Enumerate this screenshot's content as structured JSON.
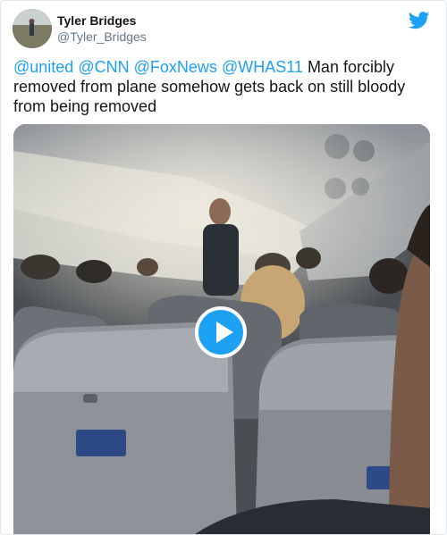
{
  "tweet": {
    "author_name": "Tyler Bridges",
    "author_handle": "@Tyler_Bridges",
    "mentions": [
      "@united",
      "@CNN",
      "@FoxNews",
      "@WHAS11"
    ],
    "text": "Man forcibly removed from plane somehow gets back on still bloody from being removed"
  },
  "colors": {
    "accent": "#1da1f2",
    "text": "#14171a",
    "secondary": "#657786"
  },
  "icons": {
    "brand": "twitter-bird-icon",
    "media_control": "play-icon"
  }
}
